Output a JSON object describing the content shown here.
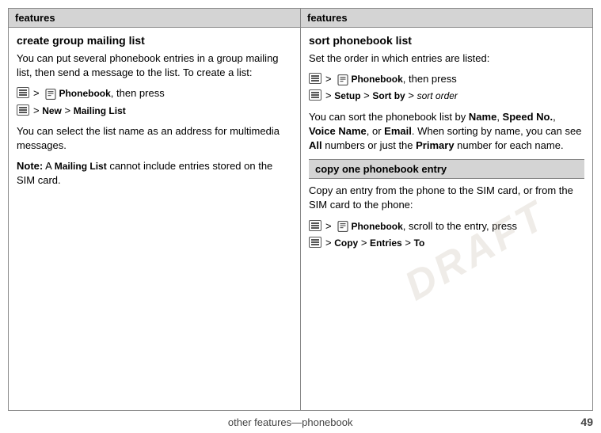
{
  "watermark": "DRAFT",
  "left_col": {
    "header": "features",
    "section_title": "create group mailing list",
    "para1": "You can put several phonebook entries in a group mailing list, then send a message to the list. To create a list:",
    "step1_text": ">  Phonebook, then press",
    "step2_text": "> New > Mailing List",
    "para2": "You can select the list name as an address for multimedia messages.",
    "note_label": "Note:",
    "note_text": "A Mailing List cannot include entries stored on the SIM card."
  },
  "right_col": {
    "header": "features",
    "section1_title": "sort phonebook list",
    "section1_para1": "Set the order in which entries are listed:",
    "sort_step1": ">  Phonebook, then press",
    "sort_step2": "> Setup > Sort by > sort order",
    "section1_para2_start": "You can sort the phonebook list by ",
    "section1_para2_name": "Name",
    "section1_para2_mid1": ", ",
    "section1_para2_speed": "Speed No.",
    "section1_para2_mid2": ", ",
    "section1_para2_voice": "Voice Name",
    "section1_para2_mid3": ", or ",
    "section1_para2_email": "Email",
    "section1_para2_mid4": ". When sorting by name, you can see ",
    "section1_para2_all": "All",
    "section1_para2_mid5": " numbers or just the ",
    "section1_para2_primary": "Primary",
    "section1_para2_end": " number for each name.",
    "section2_header": "copy one phonebook entry",
    "section2_title": "copy one phonebook entry",
    "section2_para1": "Copy an entry from the phone to the SIM card, or from the SIM card to the phone:",
    "copy_step1": ">  Phonebook, scroll to the entry, press",
    "copy_step2": "> Copy > Entries > To"
  },
  "footer": {
    "text": "other features—phonebook",
    "page": "49"
  }
}
